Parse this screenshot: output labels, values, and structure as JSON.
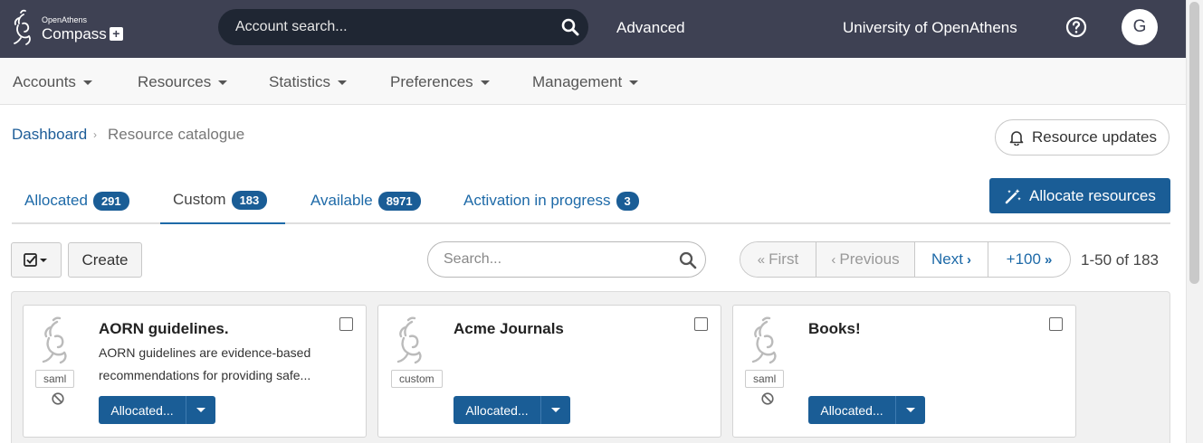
{
  "header": {
    "logo_small": "OpenAthens",
    "logo_big": "Compass",
    "logo_plus": "+",
    "search_placeholder": "Account search...",
    "advanced_label": "Advanced",
    "organisation": "University of OpenAthens",
    "avatar_initial": "G"
  },
  "nav": {
    "items": [
      {
        "label": "Accounts"
      },
      {
        "label": "Resources"
      },
      {
        "label": "Statistics"
      },
      {
        "label": "Preferences"
      },
      {
        "label": "Management"
      }
    ]
  },
  "breadcrumb": {
    "home": "Dashboard",
    "separator": "›",
    "current": "Resource catalogue"
  },
  "resource_updates_label": "Resource updates",
  "tabs": [
    {
      "label": "Allocated",
      "count": "291"
    },
    {
      "label": "Custom",
      "count": "183"
    },
    {
      "label": "Available",
      "count": "8971"
    },
    {
      "label": "Activation in progress",
      "count": "3"
    }
  ],
  "active_tab": "Custom",
  "allocate_label": "Allocate resources",
  "toolbar": {
    "create_label": "Create",
    "search_placeholder": "Search..."
  },
  "pager": {
    "first": "First",
    "previous": "Previous",
    "next": "Next",
    "plus100": "+100",
    "range": "1-50 of 183"
  },
  "cards": [
    {
      "title": "AORN guidelines.",
      "description": "AORN guidelines are evidence-based recommendations for providing safe...",
      "type": "saml",
      "status_label": "Allocated...",
      "no_entry": true
    },
    {
      "title": "Acme Journals",
      "description": "",
      "type": "custom",
      "status_label": "Allocated...",
      "no_entry": false
    },
    {
      "title": "Books!",
      "description": "",
      "type": "saml",
      "status_label": "Allocated...",
      "no_entry": true
    }
  ],
  "colors": {
    "header_bg": "#3e4153",
    "accent": "#1a5d96",
    "link": "#1e6aa8"
  },
  "icons": [
    "openathens-logo",
    "search-icon",
    "help-icon",
    "bell-icon",
    "magic-wand-icon",
    "checkbox-select-icon",
    "chevron-double-left-icon",
    "chevron-left-icon",
    "chevron-right-icon",
    "chevron-double-right-icon",
    "resource-placeholder-icon",
    "no-entry-icon"
  ]
}
